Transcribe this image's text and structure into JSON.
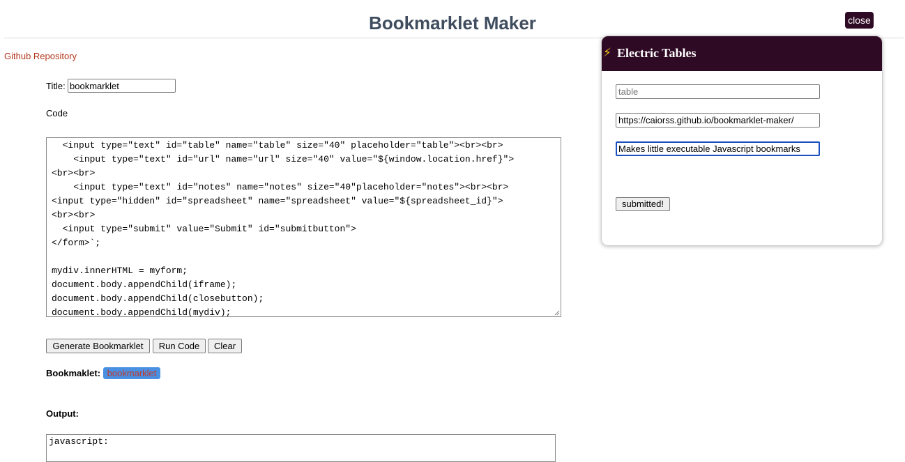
{
  "header": {
    "title": "Bookmarklet Maker",
    "repo_link": "Github Repository"
  },
  "form": {
    "title_label": "Title:",
    "title_value": "bookmarklet",
    "code_label": "Code",
    "code_value": "  <input type=\"text\" id=\"table\" name=\"table\" size=\"40\" placeholder=\"table\"><br><br>\n    <input type=\"text\" id=\"url\" name=\"url\" size=\"40\" value=\"${window.location.href}\">\n<br><br>\n    <input type=\"text\" id=\"notes\" name=\"notes\" size=\"40\"placeholder=\"notes\"><br><br>\n<input type=\"hidden\" id=\"spreadsheet\" name=\"spreadsheet\" value=\"${spreadsheet_id}\">\n<br><br>\n  <input type=\"submit\" value=\"Submit\" id=\"submitbutton\">\n</form>`;\n\nmydiv.innerHTML = myform;\ndocument.body.appendChild(iframe);\ndocument.body.appendChild(closebutton);\ndocument.body.appendChild(mydiv);"
  },
  "buttons": {
    "generate": "Generate Bookmarklet",
    "run": "Run Code",
    "clear": "Clear"
  },
  "bookmarklet": {
    "label": "Bookmaklet:",
    "link_text": "bookmarklet"
  },
  "output": {
    "label": "Output:",
    "value": "javascript:"
  },
  "overlay": {
    "close_label": "close",
    "panel_title": "Electric Tables",
    "panel_icon": "lightning-icon",
    "table_placeholder": "table",
    "url_value": "https://caiorss.github.io/bookmarklet-maker/",
    "notes_value": "Makes little executable Javascript bookmarks",
    "submit_label": "submitted!"
  },
  "colors": {
    "title": "#3f4d5e",
    "link": "#b3371d",
    "overlay_dark": "#2f0a24",
    "badge_bg": "#4a90e2",
    "focus_border": "#1a4fbf"
  }
}
